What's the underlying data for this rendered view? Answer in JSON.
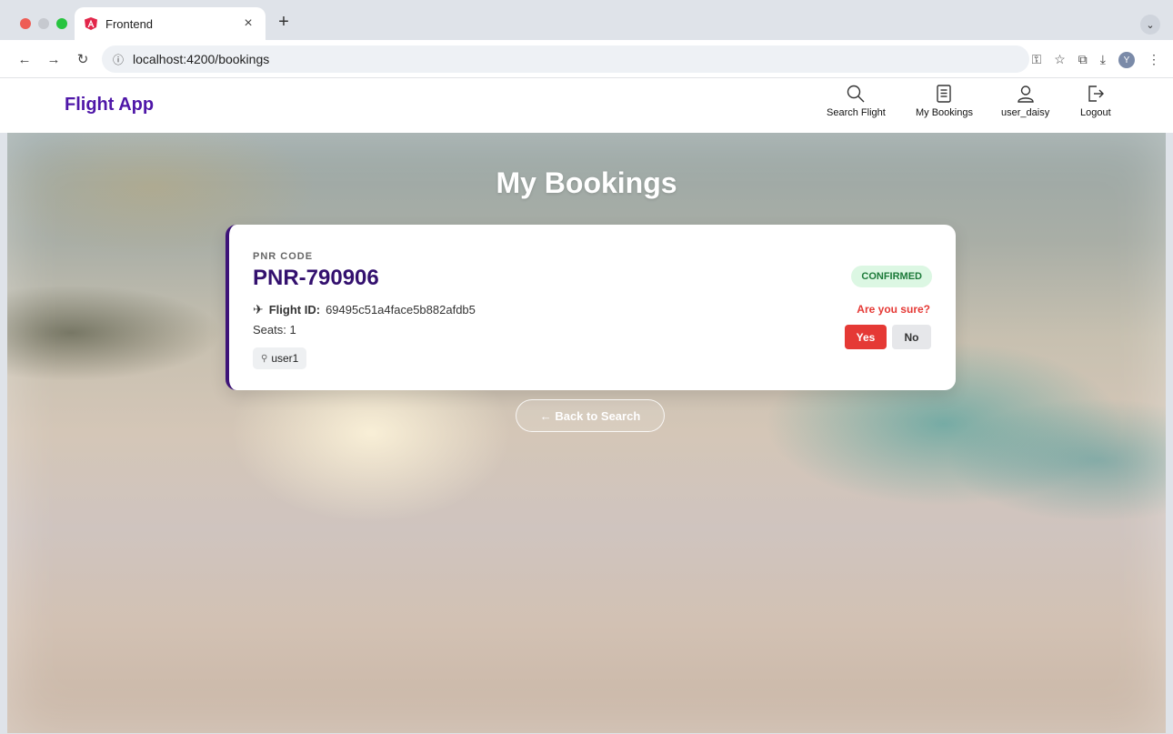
{
  "browser": {
    "tab_title": "Frontend",
    "tab_close": "×",
    "new_tab": "+",
    "url": "localhost:4200/bookings",
    "avatar_initial": "Y",
    "menu_glyph": "⌄"
  },
  "app": {
    "brand": "Flight App",
    "nav": [
      {
        "label": "Search Flight",
        "icon": "search-icon"
      },
      {
        "label": "My Bookings",
        "icon": "document-icon"
      },
      {
        "label": "user_daisy",
        "icon": "user-icon"
      },
      {
        "label": "Logout",
        "icon": "logout-icon"
      }
    ]
  },
  "page": {
    "title": "My Bookings"
  },
  "booking": {
    "pnr_label": "PNR CODE",
    "pnr_code": "PNR-790906",
    "flight_label": "Flight ID:",
    "flight_id": "69495c51a4face5b882afdb5",
    "seats": "Seats: 1",
    "user": "user1",
    "status": "CONFIRMED",
    "confirm_prompt": "Are you sure?",
    "yes_label": "Yes",
    "no_label": "No"
  },
  "back_button": "← Back to Search",
  "colors": {
    "brand": "#4f17a8",
    "pnr": "#33106e",
    "danger": "#e53935",
    "success_bg": "#dcf7e3",
    "success_text": "#1c7a39"
  }
}
